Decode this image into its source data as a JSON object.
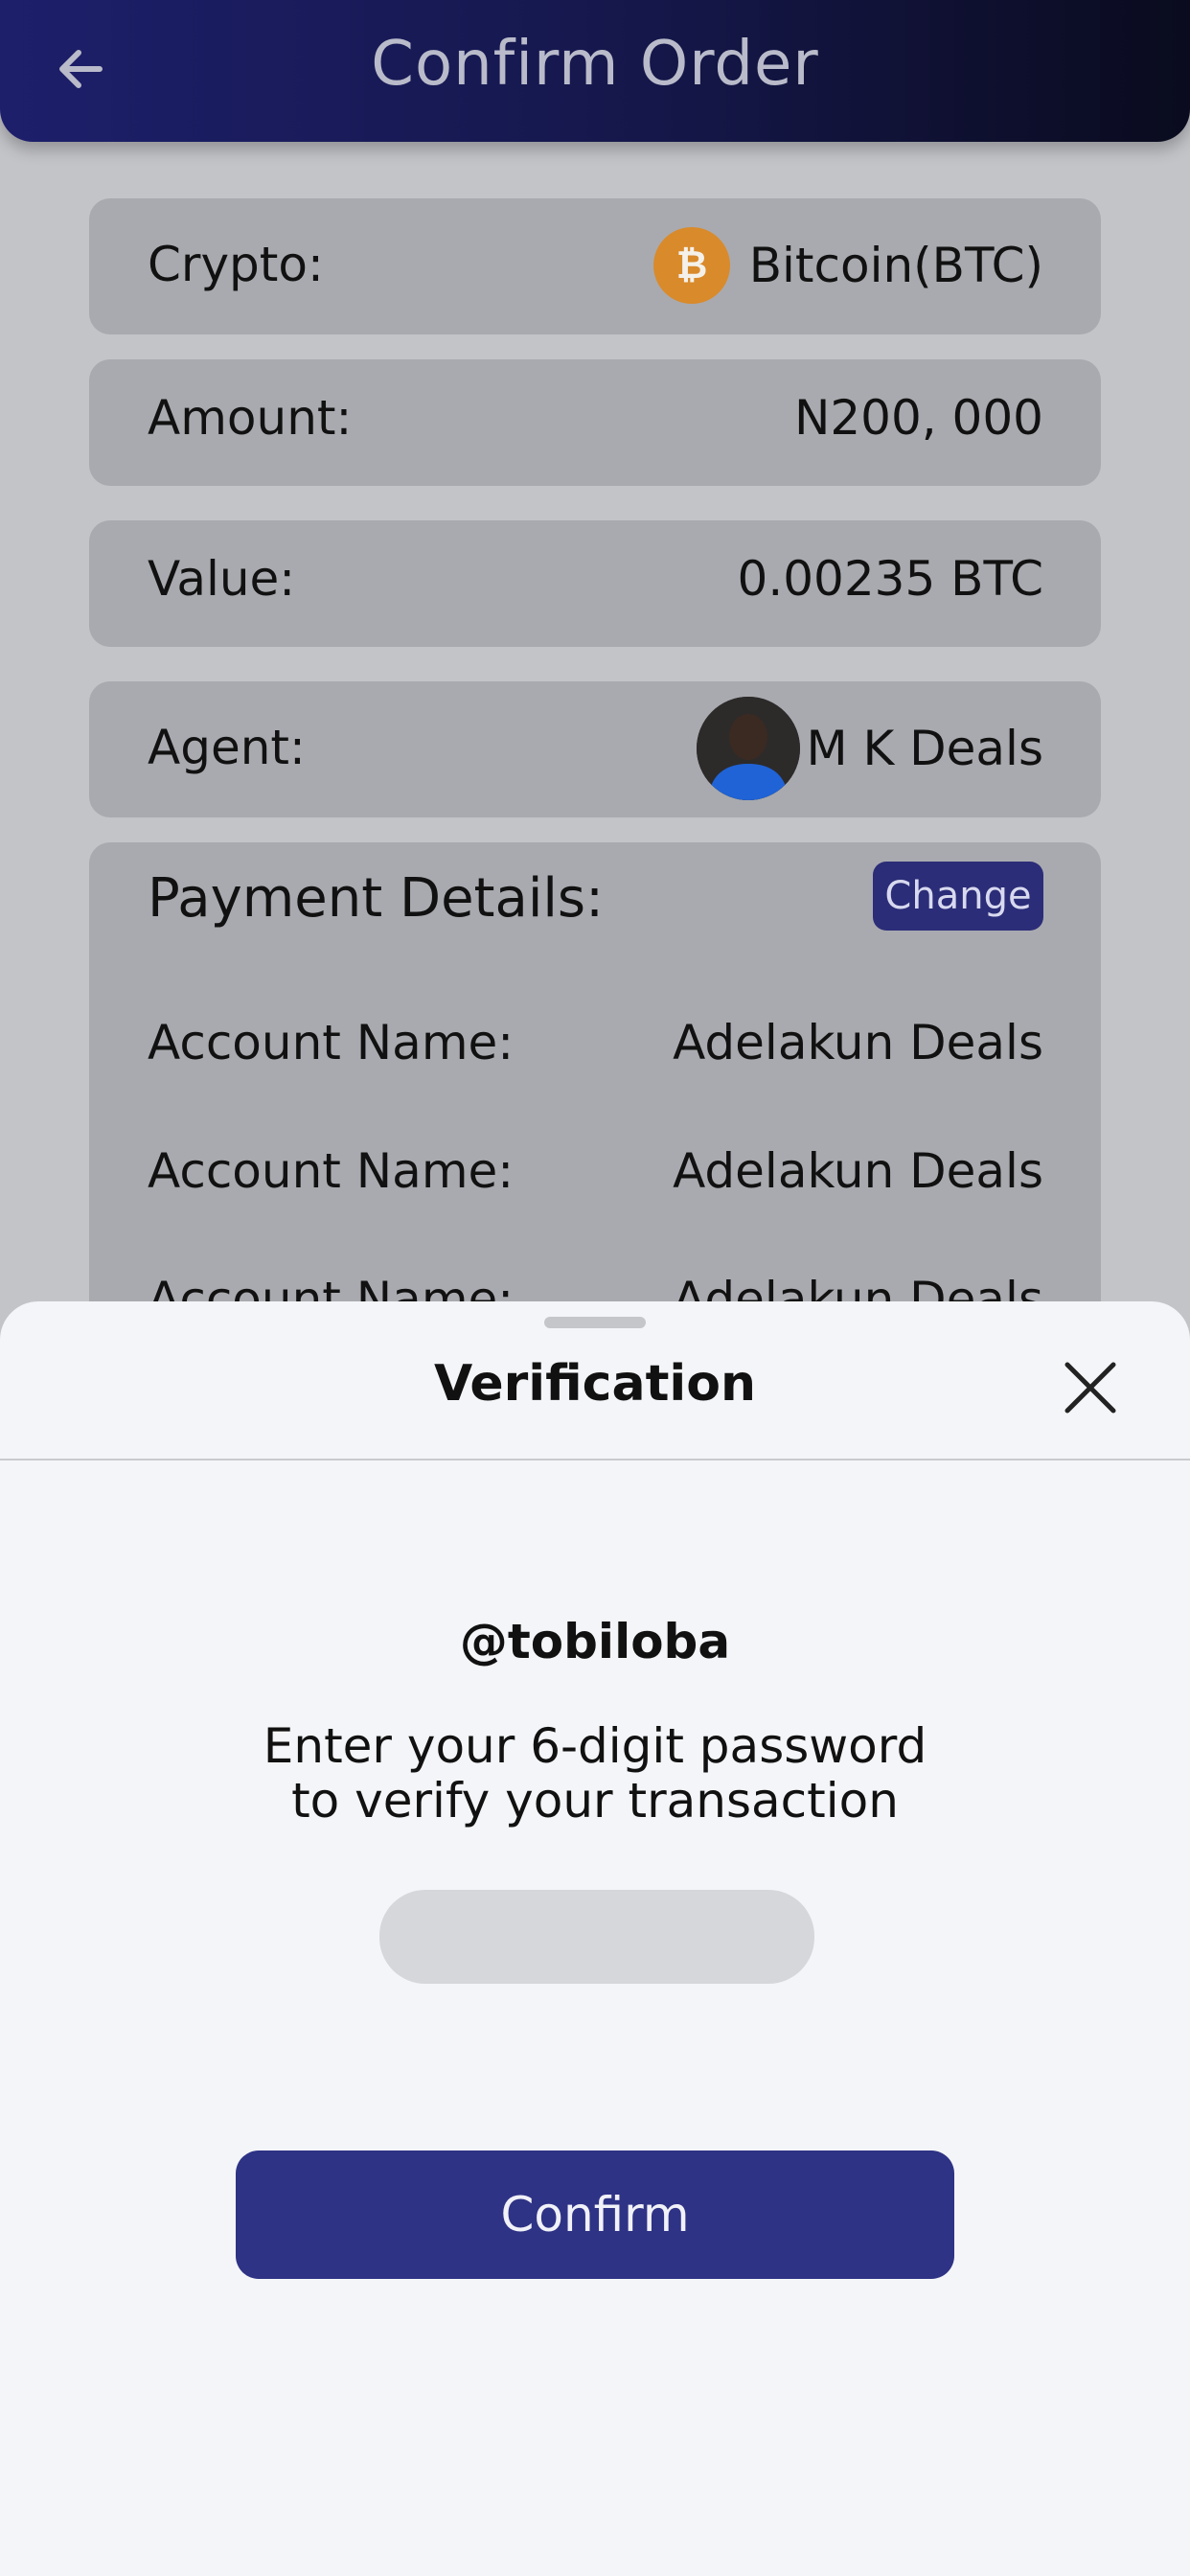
{
  "header": {
    "title": "Confirm Order"
  },
  "order": {
    "crypto_label": "Crypto:",
    "crypto_value": "Bitcoin(BTC)",
    "amount_label": "Amount:",
    "amount_value": "N200, 000",
    "value_label": "Value:",
    "value_value": "0.00235 BTC",
    "agent_label": "Agent:",
    "agent_value": "M K Deals"
  },
  "payment": {
    "title": "Payment Details:",
    "change_label": "Change",
    "rows": [
      {
        "label": "Account Name:",
        "value": "Adelakun Deals"
      },
      {
        "label": "Account Name:",
        "value": "Adelakun Deals"
      },
      {
        "label": "Account Name:",
        "value": "Adelakun Deals"
      }
    ]
  },
  "sheet": {
    "title": "Verification",
    "username": "@tobiloba",
    "instruction_line1": "Enter your 6-digit password",
    "instruction_line2": "to verify your transaction",
    "password_value": "",
    "confirm_label": "Confirm"
  },
  "colors": {
    "header_start": "#1d1f6b",
    "header_end": "#0a0b1e",
    "accent": "#2e3385",
    "card": "#a9aaaf",
    "btc": "#d98a2b"
  },
  "icons": {
    "back": "arrow-left-icon",
    "btc": "bitcoin-icon",
    "close": "close-icon"
  }
}
